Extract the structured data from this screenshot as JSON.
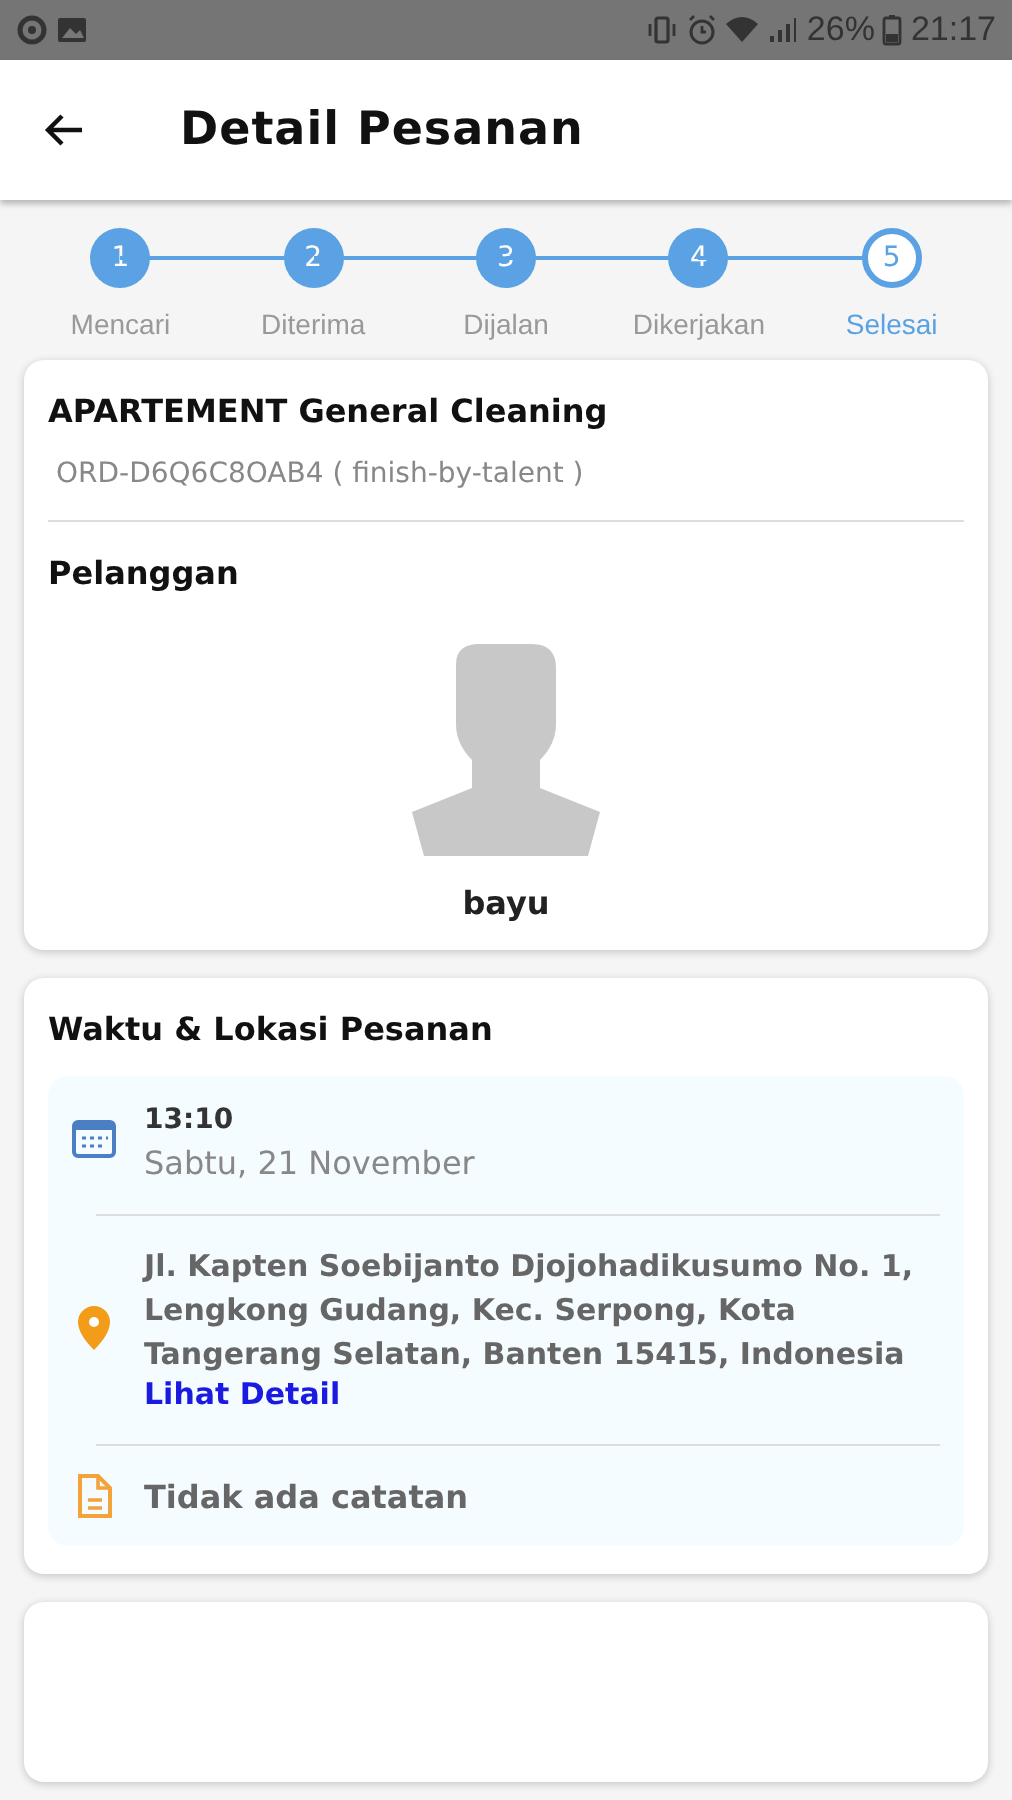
{
  "status_bar": {
    "battery": "26%",
    "time": "21:17"
  },
  "app_bar": {
    "title": "Detail Pesanan"
  },
  "steps": [
    {
      "number": "1",
      "label": "Mencari",
      "selected": false
    },
    {
      "number": "2",
      "label": "Diterima",
      "selected": false
    },
    {
      "number": "3",
      "label": "Dijalan",
      "selected": false
    },
    {
      "number": "4",
      "label": "Dikerjakan",
      "selected": false
    },
    {
      "number": "5",
      "label": "Selesai",
      "selected": true
    }
  ],
  "order_card": {
    "service": "APARTEMENT General Cleaning",
    "order_code": "ORD-D6Q6C8OAB4 ( finish-by-talent )",
    "customer_heading": "Pelanggan",
    "customer_name": "bayu"
  },
  "schedule_card": {
    "heading": "Waktu & Lokasi Pesanan",
    "time": "13:10",
    "date": "Sabtu, 21 November",
    "address": "Jl. Kapten Soebijanto Djojohadikusumo No. 1, Lengkong Gudang, Kec. Serpong, Kota Tangerang Selatan, Banten 15415, Indonesia",
    "detail_link": "Lihat Detail",
    "note": "Tidak ada catatan"
  }
}
